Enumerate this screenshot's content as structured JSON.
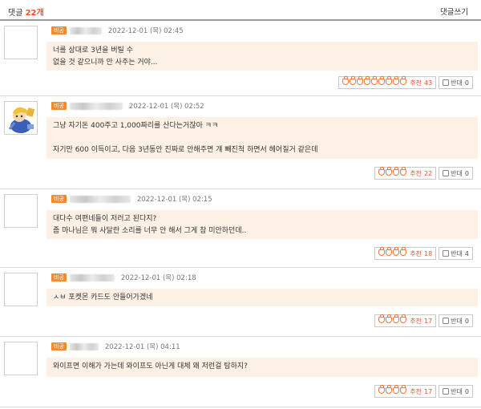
{
  "header": {
    "label": "댓글",
    "count": "22개",
    "write": "댓글쓰기"
  },
  "badge_label": "비공",
  "recommend_label": "추천",
  "oppose_label": "반대",
  "comments": [
    {
      "date": "2022-12-01 (목) 02:45",
      "lines": [
        "너를 상대로 3년을 버틸 수",
        "없을 것 같으니까 안 사주는 거야..."
      ],
      "rec_icons": 9,
      "rec_count": "43",
      "opp_count": "0",
      "avatar": "blank"
    },
    {
      "date": "2022-12-01 (목) 02:52",
      "lines": [
        "그냥 자기돈 400주고 1,000짜리를 산다는거잖아 ㅋㅋ",
        "",
        "자기만 600 이득이고, 다음 3년동안 진짜로 안해주면 걔 빼진척 하면서 헤어질거 같은데"
      ],
      "rec_icons": 4,
      "rec_count": "22",
      "opp_count": "0",
      "avatar": "character"
    },
    {
      "date": "2022-12-01 (목) 02:15",
      "lines": [
        "대다수 여편네들이 저러고 된다지?",
        "좀 마나님은 뭐 사달란 소리를 너무 안 해서 그게 참 미안하던데.."
      ],
      "rec_icons": 4,
      "rec_count": "18",
      "opp_count": "4",
      "avatar": "blank"
    },
    {
      "date": "2022-12-01 (목) 02:18",
      "lines": [
        "ㅅㅂ 포켓몬 카드도 안들어가겠네"
      ],
      "rec_icons": 4,
      "rec_count": "17",
      "opp_count": "0",
      "avatar": "blank"
    },
    {
      "date": "2022-12-01 (목) 04:11",
      "lines": [
        "와이프면 이해가 가는데 와이프도 아닌게 대체 왜 저런걸 탐하지?"
      ],
      "rec_icons": 4,
      "rec_count": "17",
      "opp_count": "0",
      "avatar": "blank"
    }
  ]
}
